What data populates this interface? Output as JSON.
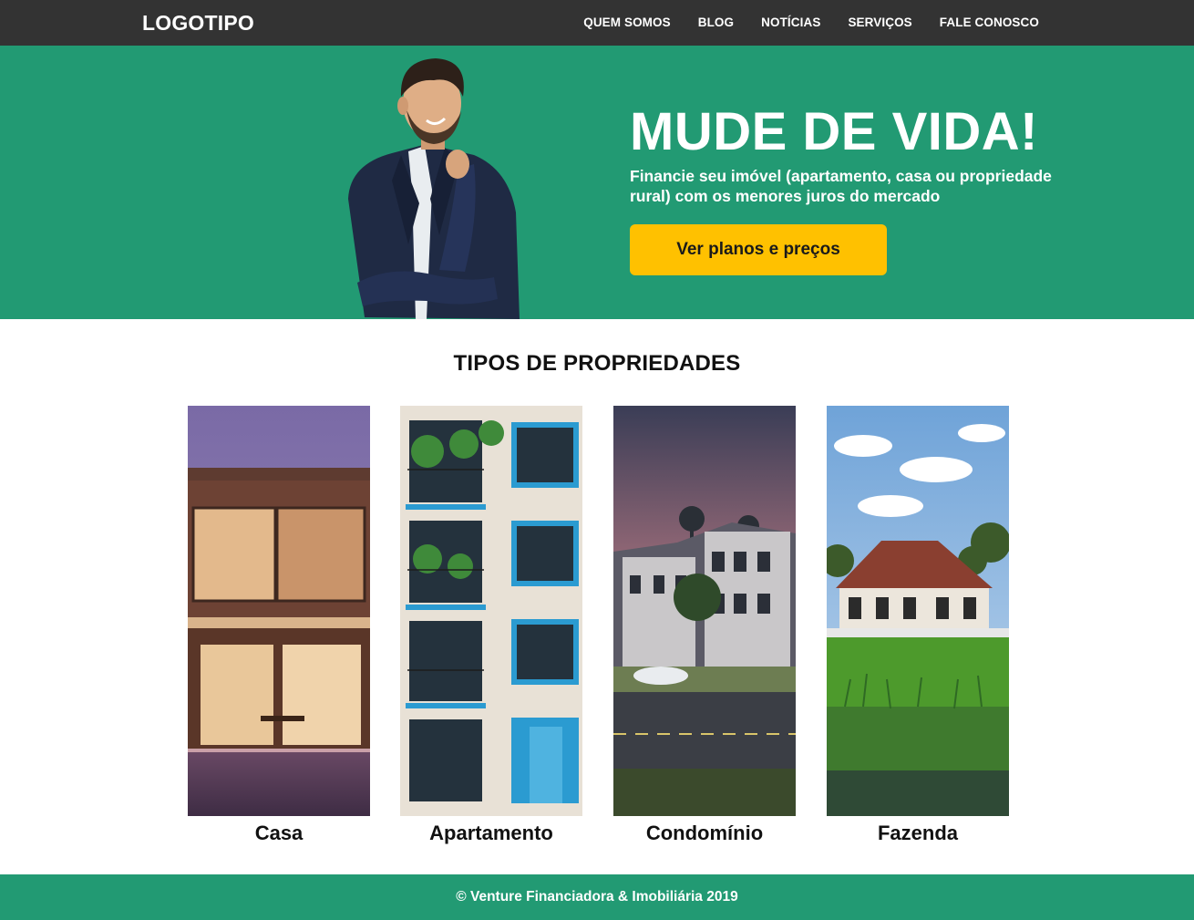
{
  "header": {
    "logo": "LOGOTIPO",
    "nav": [
      {
        "label": "QUEM SOMOS"
      },
      {
        "label": "BLOG"
      },
      {
        "label": "NOTÍCIAS"
      },
      {
        "label": "SERVIÇOS"
      },
      {
        "label": "FALE CONOSCO"
      }
    ]
  },
  "hero": {
    "title": "MUDE DE VIDA!",
    "subtitle": "Financie seu imóvel (apartamento, casa ou propriedade rural) com os menores juros do mercado",
    "cta_label": "Ver planos e preços"
  },
  "properties": {
    "title": "TIPOS DE PROPRIEDADES",
    "items": [
      {
        "label": "Casa"
      },
      {
        "label": "Apartamento"
      },
      {
        "label": "Condomínio"
      },
      {
        "label": "Fazenda"
      }
    ]
  },
  "footer": {
    "text": "© Venture Financiadora & Imobiliária 2019"
  },
  "colors": {
    "nav_bg": "#333333",
    "brand_green": "#229a73",
    "cta_yellow": "#ffc100",
    "white": "#ffffff"
  }
}
